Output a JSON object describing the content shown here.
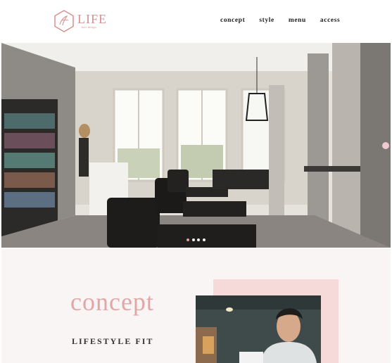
{
  "brand": {
    "name": "LIFE",
    "tagline": "hair design",
    "color": "#d98f8f"
  },
  "nav": {
    "items": [
      {
        "label": "concept"
      },
      {
        "label": "style"
      },
      {
        "label": "menu"
      },
      {
        "label": "access"
      }
    ]
  },
  "hero": {
    "slide_count": 4,
    "active_slide": 1,
    "dot_active_color": "#e9a6a6"
  },
  "concept": {
    "title": "concept",
    "subtitle": "LIFESTYLE FIT",
    "accent_color": "#e0a7a7",
    "block_color": "#f6d9d9"
  },
  "icons": [
    "logo-hexagon-icon"
  ]
}
